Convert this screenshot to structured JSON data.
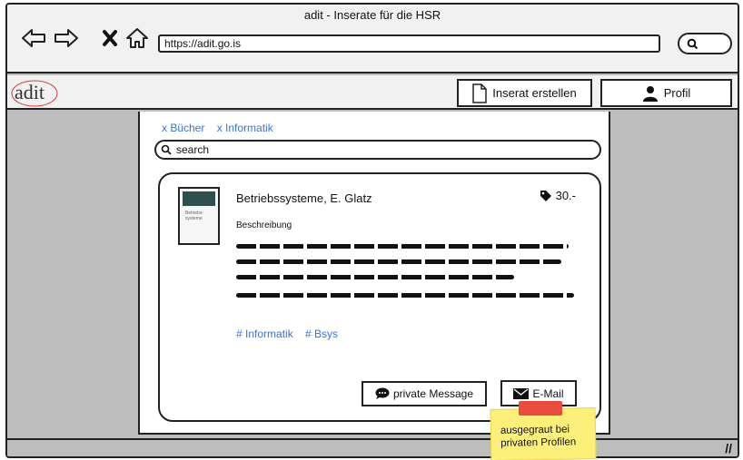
{
  "window": {
    "title": "adit - Inserate für die HSR"
  },
  "browser": {
    "url": "https://adit.go.is"
  },
  "app": {
    "logo": "adit",
    "create_button": "Inserat erstellen",
    "profile_button": "Profil"
  },
  "filters": [
    "x Bücher",
    "x Informatik"
  ],
  "search": {
    "placeholder": "search"
  },
  "listing": {
    "title": "Betriebssysteme, E. Glatz",
    "price": "30.-",
    "description_label": "Beschreibung",
    "tags": [
      "# Informatik",
      "# Bsys"
    ],
    "book_cover_lines": [
      "Betriebs-",
      "systeme"
    ]
  },
  "actions": {
    "message_label": "private Message",
    "email_label": "E-Mail"
  },
  "note": {
    "text": "ausgegraut bei privaten Profilen"
  }
}
